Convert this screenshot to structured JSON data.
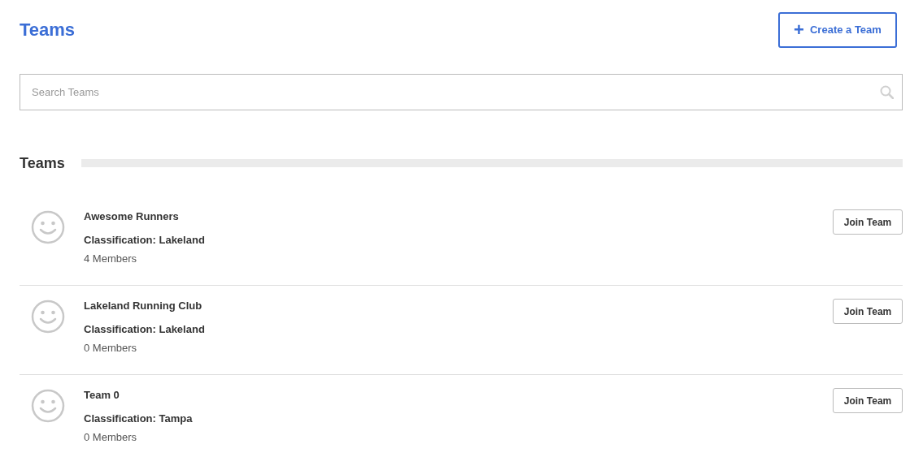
{
  "header": {
    "title": "Teams",
    "create_button": "Create a Team",
    "create_icon": "+"
  },
  "search": {
    "placeholder": "Search Teams"
  },
  "section": {
    "title": "Teams"
  },
  "teams": [
    {
      "name": "Awesome Runners",
      "classification": "Classification: Lakeland",
      "members": "4 Members",
      "button": "Join Team"
    },
    {
      "name": "Lakeland Running Club",
      "classification": "Classification: Lakeland",
      "members": "0 Members",
      "button": "Join Team"
    },
    {
      "name": "Team 0",
      "classification": "Classification: Tampa",
      "members": "0 Members",
      "button": "Join Team"
    }
  ]
}
